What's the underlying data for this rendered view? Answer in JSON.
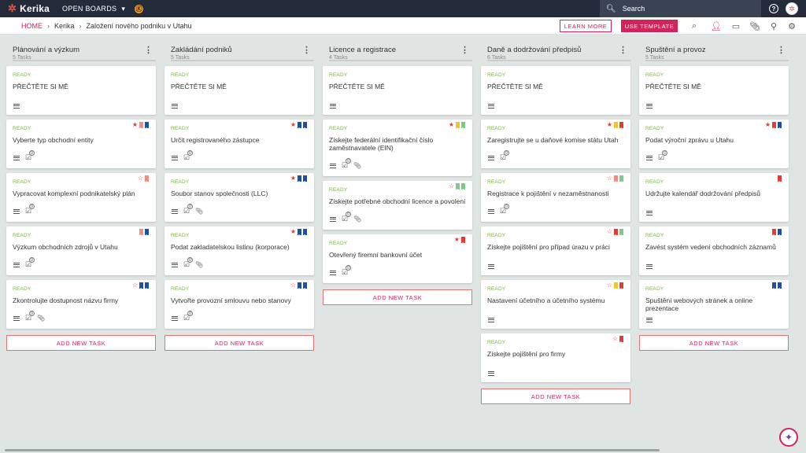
{
  "app": {
    "name": "Kerika",
    "open_boards": "OPEN BOARDS",
    "board_icon": "Ⓚ"
  },
  "search": {
    "label": "Search"
  },
  "breadcrumb": {
    "home": "HOME",
    "workspace": "Kerika",
    "board": "Založení nového podniku v Utahu"
  },
  "actions": {
    "learn_more": "LEARN MORE",
    "use_template": "USE TEMPLATE"
  },
  "colors": {
    "accent": "#d2235a",
    "topbar": "#232b3b",
    "ready": "#7cb342",
    "red": "#e53935",
    "blue": "#1e4fa3",
    "salmon": "#f28b82",
    "yellow": "#f6c12b",
    "green": "#7cc98b"
  },
  "add_task_label": "ADD NEW TASK",
  "columns": [
    {
      "title": "Plánování a výzkum",
      "count": "5 Tasks",
      "cards": [
        {
          "status": "READY",
          "title": "PŘEČTĚTE SI MĚ",
          "check": "",
          "clip": false,
          "star": "",
          "flags": []
        },
        {
          "status": "READY",
          "title": "Vyberte typ obchodní entity",
          "check": "0",
          "clip": false,
          "star": "filled",
          "flags": [
            "salmon",
            "blue"
          ]
        },
        {
          "status": "READY",
          "title": "Vypracovat komplexní podnikatelský plán",
          "check": "0",
          "clip": false,
          "star": "empty",
          "flags": [
            "salmon"
          ]
        },
        {
          "status": "READY",
          "title": "Výzkum obchodních zdrojů v Utahu",
          "check": "0",
          "clip": false,
          "star": "",
          "flags": [
            "salmon",
            "blue"
          ]
        },
        {
          "status": "READY",
          "title": "Zkontrolujte dostupnost názvu firmy",
          "check": "0",
          "clip": true,
          "star": "empty",
          "flags": [
            "blue",
            "blue"
          ]
        }
      ]
    },
    {
      "title": "Zakládání podniků",
      "count": "5 Tasks",
      "cards": [
        {
          "status": "READY",
          "title": "PŘEČTĚTE SI MĚ",
          "check": "",
          "clip": false,
          "star": "",
          "flags": []
        },
        {
          "status": "READY",
          "title": "Určit registrovaného zástupce",
          "check": "0",
          "clip": false,
          "star": "filled",
          "flags": [
            "blue",
            "blue"
          ]
        },
        {
          "status": "READY",
          "title": "Soubor stanov společnosti (LLC)",
          "check": "0",
          "clip": true,
          "star": "filled",
          "flags": [
            "blue",
            "blue"
          ]
        },
        {
          "status": "READY",
          "title": "Podat zakladatelskou listinu (korporace)",
          "check": "0",
          "clip": true,
          "star": "filled",
          "flags": [
            "blue",
            "blue"
          ]
        },
        {
          "status": "READY",
          "title": "Vytvořte provozní smlouvu nebo stanovy",
          "check": "0",
          "clip": false,
          "star": "empty",
          "flags": [
            "blue",
            "blue"
          ]
        }
      ]
    },
    {
      "title": "Licence a registrace",
      "count": "4 Tasks",
      "cards": [
        {
          "status": "READY",
          "title": "PŘEČTĚTE SI MĚ",
          "check": "",
          "clip": false,
          "star": "",
          "flags": []
        },
        {
          "status": "READY",
          "title": "Získejte federální identifikační číslo zaměstnavatele (EIN)",
          "check": "0",
          "clip": true,
          "star": "filled",
          "flags": [
            "yellow",
            "green"
          ]
        },
        {
          "status": "READY",
          "title": "Získejte potřebné obchodní licence a povolení",
          "check": "0",
          "clip": true,
          "star": "empty",
          "flags": [
            "green",
            "green"
          ]
        },
        {
          "status": "READY",
          "title": "Otevřený firemní bankovní účet",
          "check": "0",
          "clip": false,
          "star": "filled",
          "flags": [
            "red"
          ]
        }
      ]
    },
    {
      "title": "Daně a dodržování předpisů",
      "count": "6 Tasks",
      "cards": [
        {
          "status": "READY",
          "title": "PŘEČTĚTE SI MĚ",
          "check": "",
          "clip": false,
          "star": "",
          "flags": []
        },
        {
          "status": "READY",
          "title": "Zaregistrujte se u daňové komise státu Utah",
          "check": "0",
          "clip": false,
          "star": "filled",
          "flags": [
            "yellow",
            "red"
          ]
        },
        {
          "status": "READY",
          "title": "Registrace k pojištění v nezaměstnanosti",
          "check": "0",
          "clip": false,
          "star": "empty",
          "flags": [
            "salmon",
            "green"
          ]
        },
        {
          "status": "READY",
          "title": "Získejte pojištění pro případ úrazu v práci",
          "check": "",
          "clip": false,
          "star": "empty",
          "flags": [
            "red",
            "green"
          ]
        },
        {
          "status": "READY",
          "title": "Nastavení účetního a účetního systému",
          "check": "",
          "clip": false,
          "star": "empty",
          "flags": [
            "yellow",
            "red"
          ]
        },
        {
          "status": "READY",
          "title": "Získejte pojištění pro firmy",
          "check": "",
          "clip": false,
          "star": "empty",
          "flags": [
            "red"
          ]
        }
      ]
    },
    {
      "title": "Spuštění a provoz",
      "count": "5 Tasks",
      "cards": [
        {
          "status": "READY",
          "title": "PŘEČTĚTE SI MĚ",
          "check": "",
          "clip": false,
          "star": "",
          "flags": []
        },
        {
          "status": "READY",
          "title": "Podat výroční zprávu u Utahu",
          "check": "0",
          "clip": false,
          "star": "filled",
          "flags": [
            "red",
            "blue"
          ]
        },
        {
          "status": "READY",
          "title": "Udržujte kalendář dodržování předpisů",
          "check": "",
          "clip": false,
          "star": "",
          "flags": [
            "red"
          ]
        },
        {
          "status": "READY",
          "title": "Zavést systém vedení obchodních záznamů",
          "check": "",
          "clip": false,
          "star": "",
          "flags": [
            "red",
            "blue"
          ]
        },
        {
          "status": "READY",
          "title": "Spuštění webových stránek a online prezentace",
          "check": "",
          "clip": false,
          "star": "",
          "flags": [
            "blue",
            "blue"
          ]
        }
      ]
    }
  ]
}
